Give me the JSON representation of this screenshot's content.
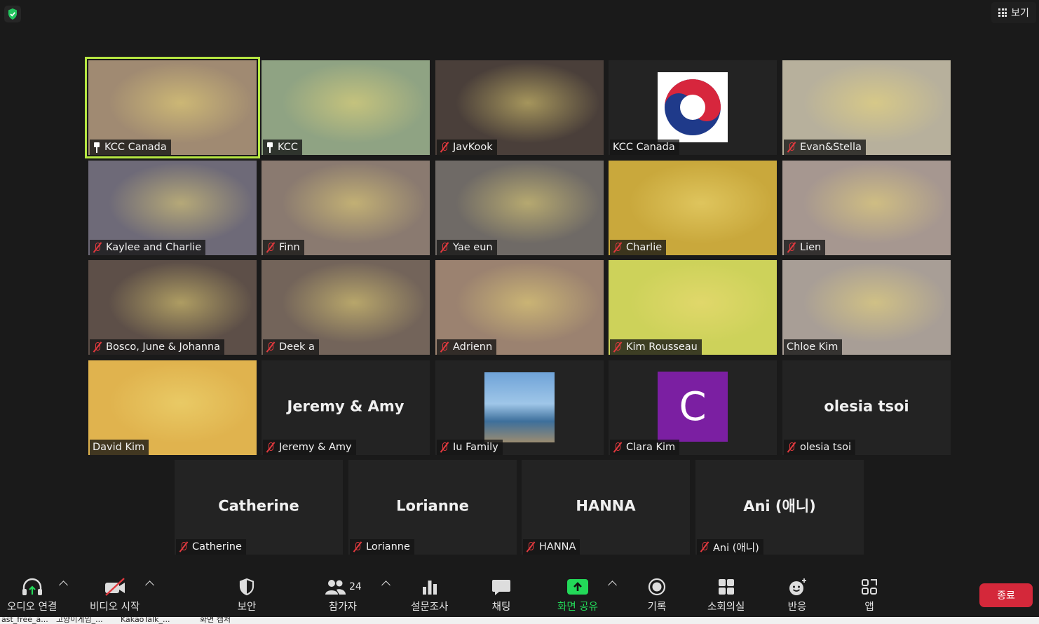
{
  "header": {
    "view_label": "보기"
  },
  "tiles": [
    {
      "name": "KCC Canada",
      "icon": "pin-icon",
      "active": true,
      "bg": "#a08a72"
    },
    {
      "name": "KCC",
      "icon": "pin-icon",
      "bg": "#8fa383"
    },
    {
      "name": "JavKook",
      "icon": "mic-muted-icon",
      "bg": "#4a3f3a"
    },
    {
      "name": "KCC Canada",
      "icon": "",
      "bg": "#232323"
    },
    {
      "name": "Evan&Stella",
      "icon": "mic-muted-icon",
      "bg": "#b7b09c"
    },
    {
      "name": "Kaylee and Charlie",
      "icon": "mic-muted-icon",
      "bg": "#6e6a78"
    },
    {
      "name": "Finn",
      "icon": "mic-muted-icon",
      "bg": "#8a7a70"
    },
    {
      "name": "Yae eun",
      "icon": "mic-muted-icon",
      "bg": "#6f6a66"
    },
    {
      "name": "Charlie",
      "icon": "mic-muted-icon",
      "bg": "#c9a83c"
    },
    {
      "name": "Lien",
      "icon": "mic-muted-icon",
      "bg": "#a69790"
    },
    {
      "name": "Bosco, June & Johanna",
      "icon": "mic-muted-icon",
      "bg": "#5d4f48"
    },
    {
      "name": "Deek a",
      "icon": "mic-muted-icon",
      "bg": "#73645a"
    },
    {
      "name": "Adrienn",
      "icon": "mic-muted-icon",
      "bg": "#9b8270"
    },
    {
      "name": "Kim Rousseau",
      "icon": "mic-muted-icon",
      "bg": "#cdd25a"
    },
    {
      "name": "Chloe Kim",
      "icon": "",
      "bg": "#a89e96"
    },
    {
      "name": "David Kim",
      "icon": "",
      "bg": "#e0b34e"
    },
    {
      "name": "Jeremy & Amy",
      "display": "Jeremy & Amy",
      "icon": "mic-muted-icon",
      "bg": "#232323"
    },
    {
      "name": "Iu Family",
      "icon": "mic-muted-icon",
      "bg": "#232323"
    },
    {
      "name": "Clara Kim",
      "avatar": "C",
      "icon": "mic-muted-icon",
      "bg": "#232323"
    },
    {
      "name": "olesia tsoi",
      "display": "olesia tsoi",
      "icon": "mic-muted-icon",
      "bg": "#232323"
    },
    {
      "name": "Catherine",
      "display": "Catherine",
      "icon": "mic-muted-icon",
      "bg": "#232323"
    },
    {
      "name": "Lorianne",
      "display": "Lorianne",
      "icon": "mic-muted-icon",
      "bg": "#232323"
    },
    {
      "name": "HANNA",
      "display": "HANNA",
      "icon": "mic-muted-icon",
      "bg": "#232323"
    },
    {
      "name": "Ani (애니)",
      "display": "Ani (애니)",
      "icon": "mic-muted-icon",
      "bg": "#232323"
    }
  ],
  "toolbar": {
    "audio": "오디오 연결",
    "video": "비디오 시작",
    "security": "보안",
    "participants": "참가자",
    "participants_count": "24",
    "polls": "설문조사",
    "chat": "채팅",
    "share": "화면 공유",
    "record": "기록",
    "breakout": "소회의실",
    "reactions": "반응",
    "apps": "앱",
    "end": "종료"
  },
  "taskbar": [
    "ast_free_a...",
    "고양이게임_...",
    "KakaoTalk_...",
    "화면 캡처"
  ],
  "colors": {
    "active_border": "#b6e642",
    "muted_mic": "#e0393e",
    "share_green": "#23d959",
    "end_red": "#d4283a",
    "avatar_purple": "#7b1fa2"
  }
}
